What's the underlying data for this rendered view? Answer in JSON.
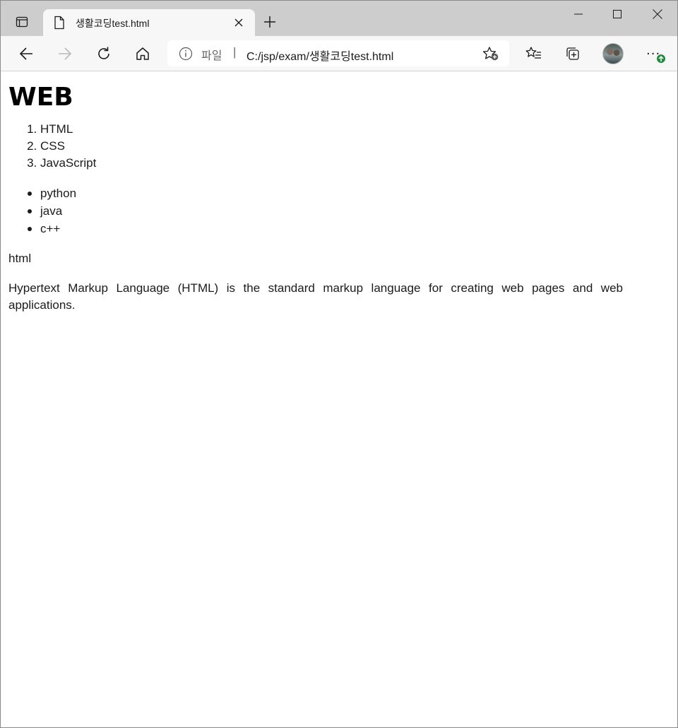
{
  "browser": {
    "tab": {
      "title": "생활코딩test.html"
    },
    "address": {
      "scheme": "파일",
      "separator": "|",
      "url": "C:/jsp/exam/생활코딩test.html"
    },
    "badge_color": "#1f8a3b"
  },
  "page": {
    "heading": "WEB",
    "ordered_list": [
      "HTML",
      "CSS",
      "JavaScript"
    ],
    "unordered_list": [
      "python",
      "java",
      "c++"
    ],
    "term": "html",
    "description": "Hypertext Markup Language (HTML) is the standard markup language for creating web pages and web applications."
  }
}
